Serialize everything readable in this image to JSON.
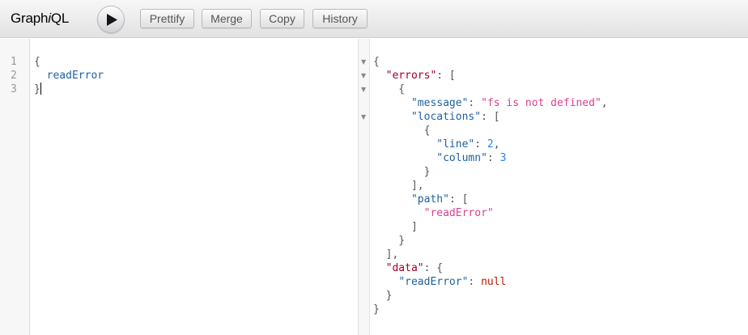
{
  "toolbar": {
    "logo_prefix": "Graph",
    "logo_italic": "i",
    "logo_suffix": "QL",
    "prettify_label": "Prettify",
    "merge_label": "Merge",
    "copy_label": "Copy",
    "history_label": "History"
  },
  "query": {
    "line_numbers": [
      "1",
      "2",
      "3"
    ],
    "lines": [
      "{",
      "  readError",
      "}"
    ]
  },
  "result": {
    "lines": [
      "{",
      "  \"errors\": [",
      "    {",
      "      \"message\": \"fs is not defined\",",
      "      \"locations\": [",
      "        {",
      "          \"line\": 2,",
      "          \"column\": 3",
      "        }",
      "      ],",
      "      \"path\": [",
      "        \"readError\"",
      "      ]",
      "    }",
      "  ],",
      "  \"data\": {",
      "    \"readError\": null",
      "  }",
      "}"
    ],
    "tokens": {
      "errors_key": "\"errors\"",
      "message_key": "\"message\"",
      "message_value": "\"fs is not defined\"",
      "locations_key": "\"locations\"",
      "line_key": "\"line\"",
      "line_value": "2",
      "column_key": "\"column\"",
      "column_value": "3",
      "path_key": "\"path\"",
      "path_value": "\"readError\"",
      "data_key": "\"data\"",
      "readError_key": "\"readError\"",
      "null_value": "null"
    }
  },
  "icons": {
    "execute": "play-icon",
    "fold": "fold-arrow-icon"
  },
  "colors": {
    "key": "#a0002a",
    "string": "#d64292",
    "number": "#2882f9",
    "keyword": "#b11a04",
    "property": "#1f61a0"
  }
}
